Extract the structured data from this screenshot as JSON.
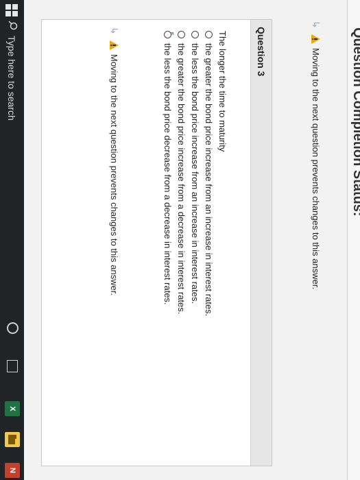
{
  "header": {
    "title": "Question Completion Status:"
  },
  "warnings": {
    "top": "Moving to the next question prevents changes to this answer.",
    "bottom": "Moving to the next question prevents changes to this answer."
  },
  "question": {
    "label": "Question 3",
    "stem": "The longer the time to maturity",
    "options": [
      "the greater the bond price increase from an increase in interest rates.",
      "the less the bond price increase from an increase in interest rates.",
      "the greater the bond price increase from a decrease in interest rates.",
      "the less the bond price decrease from a decrease in interest rates."
    ]
  },
  "taskbar": {
    "search_placeholder": "Type here to search",
    "apps": {
      "excel_letter": "X",
      "onenote_letter": "N"
    }
  },
  "icons": {
    "arrow": "arrow-right-icon",
    "alert": "alert-triangle-icon",
    "windows": "windows-start-icon",
    "search": "search-icon"
  },
  "colors": {
    "alert": "#e8a90b",
    "taskbar": "#202426",
    "excel": "#1f7244",
    "onenote": "#c33f2f",
    "files": "#f3c74b"
  }
}
